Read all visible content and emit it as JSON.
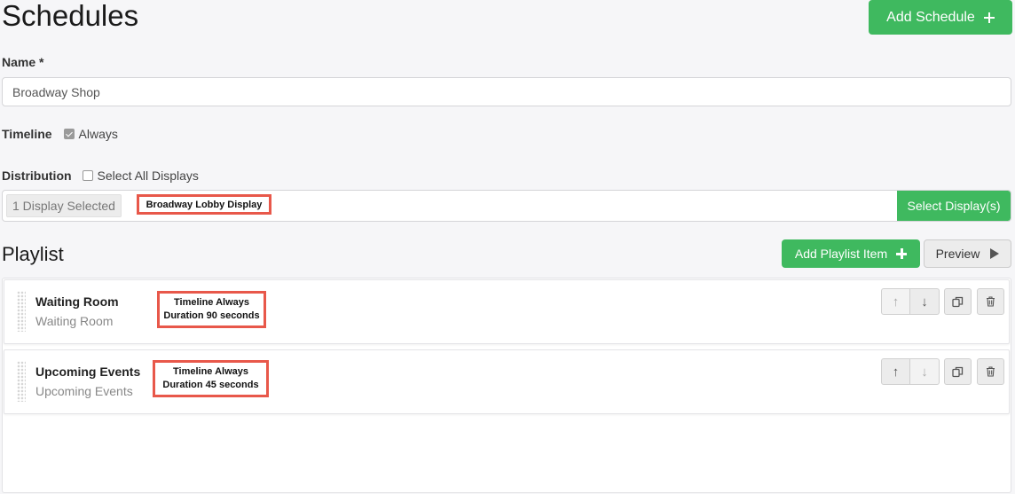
{
  "page": {
    "title": "Schedules",
    "add_schedule_label": "Add Schedule"
  },
  "name_field": {
    "label": "Name *",
    "value": "Broadway Shop"
  },
  "timeline": {
    "label": "Timeline",
    "option_label": "Always",
    "checked": true
  },
  "distribution": {
    "label": "Distribution",
    "select_all_label": "Select All Displays",
    "select_all_checked": false,
    "selected_count_label": "1 Display Selected",
    "selected_display": "Broadway Lobby Display",
    "select_button_label": "Select Display(s)"
  },
  "playlist": {
    "title": "Playlist",
    "add_item_label": "Add Playlist Item",
    "preview_label": "Preview",
    "items": [
      {
        "name": "Waiting Room",
        "subtitle": "Waiting Room",
        "timeline": "Timeline Always",
        "duration": "Duration 90 seconds"
      },
      {
        "name": "Upcoming Events",
        "subtitle": "Upcoming Events",
        "timeline": "Timeline Always",
        "duration": "Duration 45 seconds"
      }
    ]
  },
  "colors": {
    "accent_green": "#3fb95f",
    "highlight_red": "#e8584a"
  }
}
